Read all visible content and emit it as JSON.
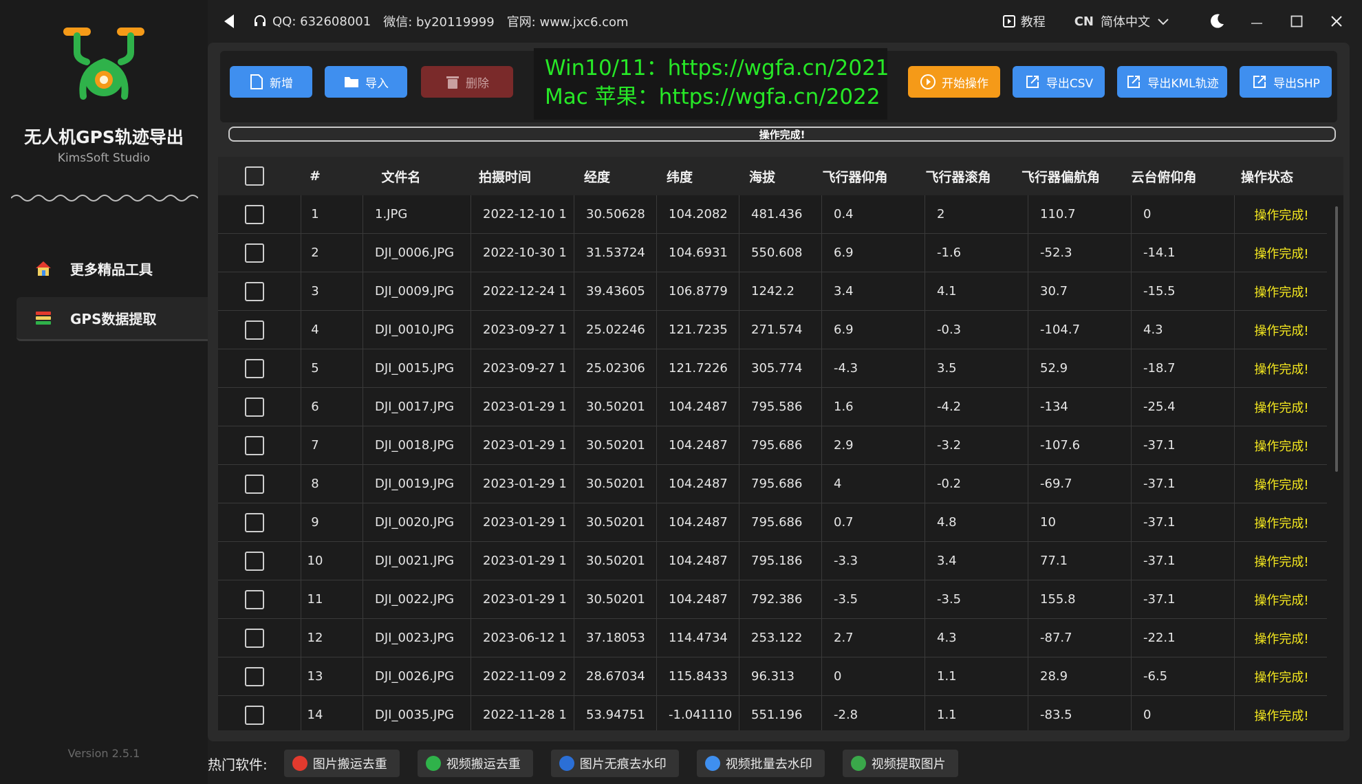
{
  "sidebar": {
    "title": "无人机GPS轨迹导出",
    "subtitle": "KimsSoft Studio",
    "nav": [
      {
        "label": "更多精品工具"
      },
      {
        "label": "GPS数据提取"
      }
    ],
    "version": "Version 2.5.1"
  },
  "topbar": {
    "qq": "QQ:  632608001",
    "wechat": "微信:  by20119999",
    "website": "官网:  www.jxc6.com",
    "tutorial": "教程",
    "lang_code": "CN",
    "lang_name": "简体中文"
  },
  "toolbar": {
    "add": "新增",
    "import": "导入",
    "delete": "删除",
    "promo_line1": "Win10/11：https://wgfa.cn/2021",
    "promo_line2": "Mac 苹果：https://wgfa.cn/2022",
    "start": "开始操作",
    "export_csv": "导出CSV",
    "export_kml": "导出KML轨迹",
    "export_shp": "导出SHP"
  },
  "progress": {
    "text": "操作完成!",
    "value": 1.0
  },
  "table": {
    "columns": [
      "#",
      "文件名",
      "拍摄时间",
      "经度",
      "纬度",
      "海拔",
      "飞行器仰角",
      "飞行器滚角",
      "飞行器偏航角",
      "云台俯仰角",
      "操作状态"
    ],
    "rows": [
      [
        "1",
        "1.JPG",
        "2022-12-10 1",
        "30.50628",
        "104.2082",
        "481.436",
        "0.4",
        "2",
        "110.7",
        "0",
        "操作完成!"
      ],
      [
        "2",
        "DJI_0006.JPG",
        "2022-10-30 1",
        "31.53724",
        "104.6931",
        "550.608",
        "6.9",
        "-1.6",
        "-52.3",
        "-14.1",
        "操作完成!"
      ],
      [
        "3",
        "DJI_0009.JPG",
        "2022-12-24 1",
        "39.43605",
        "106.8779",
        "1242.2",
        "3.4",
        "4.1",
        "30.7",
        "-15.5",
        "操作完成!"
      ],
      [
        "4",
        "DJI_0010.JPG",
        "2023-09-27 1",
        "25.02246",
        "121.7235",
        "271.574",
        "6.9",
        "-0.3",
        "-104.7",
        "4.3",
        "操作完成!"
      ],
      [
        "5",
        "DJI_0015.JPG",
        "2023-09-27 1",
        "25.02306",
        "121.7226",
        "305.774",
        "-4.3",
        "3.5",
        "52.9",
        "-18.7",
        "操作完成!"
      ],
      [
        "6",
        "DJI_0017.JPG",
        "2023-01-29 1",
        "30.50201",
        "104.2487",
        "795.586",
        "1.6",
        "-4.2",
        "-134",
        "-25.4",
        "操作完成!"
      ],
      [
        "7",
        "DJI_0018.JPG",
        "2023-01-29 1",
        "30.50201",
        "104.2487",
        "795.686",
        "2.9",
        "-3.2",
        "-107.6",
        "-37.1",
        "操作完成!"
      ],
      [
        "8",
        "DJI_0019.JPG",
        "2023-01-29 1",
        "30.50201",
        "104.2487",
        "795.686",
        "4",
        "-0.2",
        "-69.7",
        "-37.1",
        "操作完成!"
      ],
      [
        "9",
        "DJI_0020.JPG",
        "2023-01-29 1",
        "30.50201",
        "104.2487",
        "795.686",
        "0.7",
        "4.8",
        "10",
        "-37.1",
        "操作完成!"
      ],
      [
        "10",
        "DJI_0021.JPG",
        "2023-01-29 1",
        "30.50201",
        "104.2487",
        "795.186",
        "-3.3",
        "3.4",
        "77.1",
        "-37.1",
        "操作完成!"
      ],
      [
        "11",
        "DJI_0022.JPG",
        "2023-01-29 1",
        "30.50201",
        "104.2487",
        "792.386",
        "-3.5",
        "-3.5",
        "155.8",
        "-37.1",
        "操作完成!"
      ],
      [
        "12",
        "DJI_0023.JPG",
        "2023-06-12 1",
        "37.18053",
        "114.4734",
        "253.122",
        "2.7",
        "4.3",
        "-87.7",
        "-22.1",
        "操作完成!"
      ],
      [
        "13",
        "DJI_0026.JPG",
        "2022-11-09 2",
        "28.67034",
        "115.8433",
        "96.313",
        "0",
        "1.1",
        "28.9",
        "-6.5",
        "操作完成!"
      ],
      [
        "14",
        "DJI_0035.JPG",
        "2022-11-28 1",
        "53.94751",
        "-1.041110",
        "551.196",
        "-2.8",
        "1.1",
        "-83.5",
        "0",
        "操作完成!"
      ]
    ]
  },
  "hotbar": {
    "label": "热门软件:",
    "items": [
      {
        "label": "图片搬运去重",
        "color": "#e23a2e"
      },
      {
        "label": "视频搬运去重",
        "color": "#2fb24a"
      },
      {
        "label": "图片无痕去水印",
        "color": "#2b6fd6"
      },
      {
        "label": "视频批量去水印",
        "color": "#3f8fef"
      },
      {
        "label": "视频提取图片",
        "color": "#3aa84a"
      }
    ]
  },
  "colors": {
    "accent_blue": "#3f8fef",
    "start_orange": "#f59a18",
    "delete_red": "#7a2a2a",
    "status_yellow": "#f5e81f",
    "promo_green": "#27e827"
  }
}
